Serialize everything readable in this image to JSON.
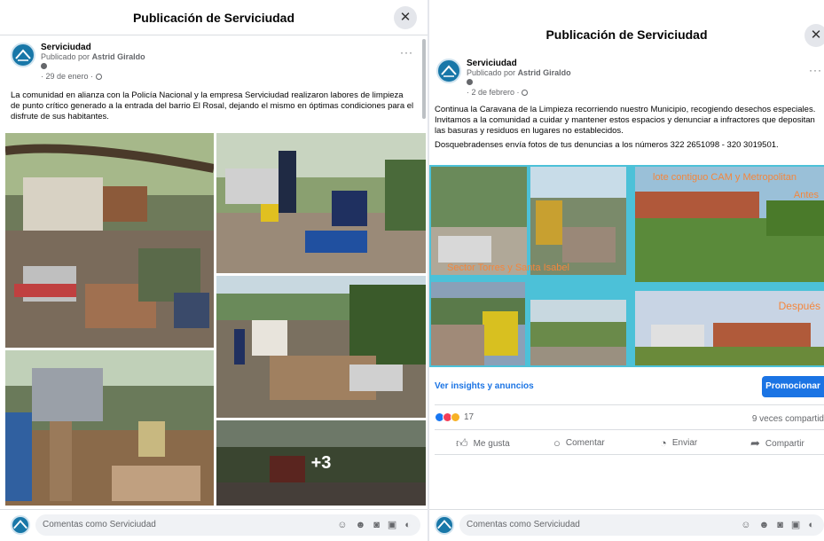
{
  "left": {
    "header_title": "Publicación de Serviciudad",
    "page_name": "Serviciudad",
    "published_by_prefix": "Publicado por",
    "published_by_name": "Astrid Giraldo",
    "date": "29 de enero",
    "post_text": "La comunidad en alianza con la Policía Nacional y la empresa Serviciudad realizaron labores de limpieza de punto crítico generado a la entrada del barrio El Rosal, dejando el mismo en óptimas condiciones para el disfrute de sus habitantes.",
    "more_photos": "+3",
    "comment_placeholder": "Comentas como Serviciudad"
  },
  "right": {
    "header_title": "Publicación de Serviciudad",
    "page_name": "Serviciudad",
    "published_by_prefix": "Publicado por",
    "published_by_name": "Astrid Giraldo",
    "date": "2 de febrero",
    "post_text_1": "Continua la Caravana de la Limpieza recorriendo nuestro Municipio, recogiendo desechos especiales. Invitamos a la comunidad a cuidar y mantener estos espacios y denunciar a infractores que depositan las basuras y residuos en lugares no establecidos.",
    "post_text_2": "Dosquebradenses envía fotos de tus denuncias a los números 322 2651098 - 320 3019501.",
    "image_caption_top": "lote contiguo CAM y Metropolitan",
    "image_caption_antes": "Antes",
    "image_caption_despues": "Después",
    "image_caption_left": "Sector Torres y Santa Isabel",
    "insights_link": "Ver insights y anuncios",
    "promote_button": "Promocionar",
    "reaction_count": "17",
    "share_count": "9 veces compartid",
    "like_label": "Me gusta",
    "comment_label": "Comentar",
    "send_label": "Enviar",
    "share_label": "Compartir",
    "comment_placeholder": "Comentas como Serviciudad"
  },
  "colors": {
    "accent": "#1b74e4",
    "caption_orange": "#f4863c",
    "frame_cyan": "#4cc1d8"
  }
}
